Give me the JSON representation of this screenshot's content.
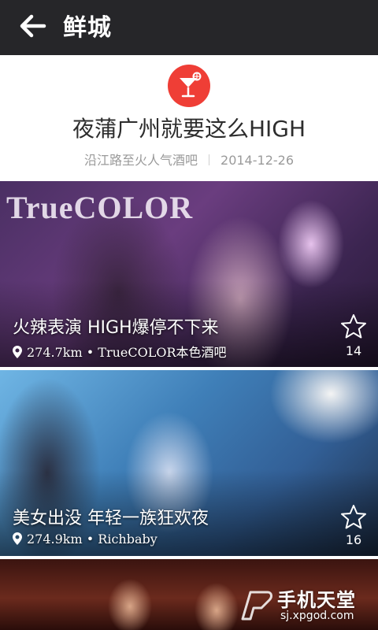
{
  "app_bar": {
    "title": "鲜城",
    "back_icon": "back-arrow-icon",
    "background": "#262629"
  },
  "header": {
    "badge_icon": "cocktail-icon",
    "badge_color": "#ef3e36",
    "title": "夜蒲广州就要这么HIGH",
    "location": "沿江路至火人气酒吧",
    "date": "2014-12-26"
  },
  "cards": [
    {
      "sign_text": "TrueCOLOR",
      "title": "火辣表演 HIGH爆停不下来",
      "distance": "274.7km",
      "separator": "•",
      "venue": "TrueCOLOR本色酒吧",
      "favorite_icon": "star-outline-icon",
      "favorite_count": "14"
    },
    {
      "title": "美女出没 年轻一族狂欢夜",
      "distance": "274.9km",
      "separator": "•",
      "venue": "Richbaby",
      "favorite_icon": "star-outline-icon",
      "favorite_count": "16"
    },
    {
      "title": ""
    }
  ],
  "watermark": {
    "name": "手机天堂",
    "url": "sj.xpgod.com"
  }
}
